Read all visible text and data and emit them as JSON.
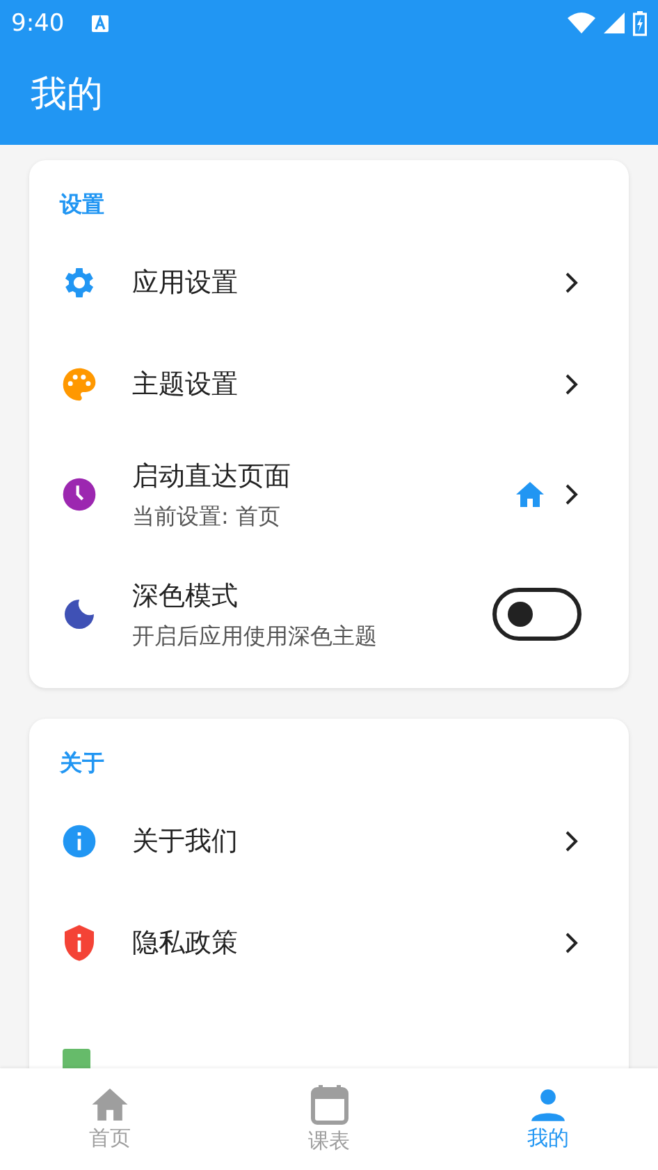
{
  "status_bar": {
    "time": "9:40"
  },
  "app_bar": {
    "title": "我的"
  },
  "sections": [
    {
      "title": "设置",
      "items": [
        {
          "kind": "link",
          "label": "应用设置"
        },
        {
          "kind": "link",
          "label": "主题设置"
        },
        {
          "kind": "link",
          "label": "启动直达页面",
          "subtitle": "当前设置: 首页",
          "home_badge": true
        },
        {
          "kind": "toggle",
          "label": "深色模式",
          "subtitle": "开启后应用使用深色主题",
          "on": false
        }
      ]
    },
    {
      "title": "关于",
      "items": [
        {
          "kind": "link",
          "label": "关于我们"
        },
        {
          "kind": "link",
          "label": "隐私政策"
        },
        {
          "kind": "partial"
        }
      ]
    }
  ],
  "bottom_nav": [
    {
      "label": "首页",
      "selected": false
    },
    {
      "label": "课表",
      "selected": false
    },
    {
      "label": "我的",
      "selected": true
    }
  ]
}
